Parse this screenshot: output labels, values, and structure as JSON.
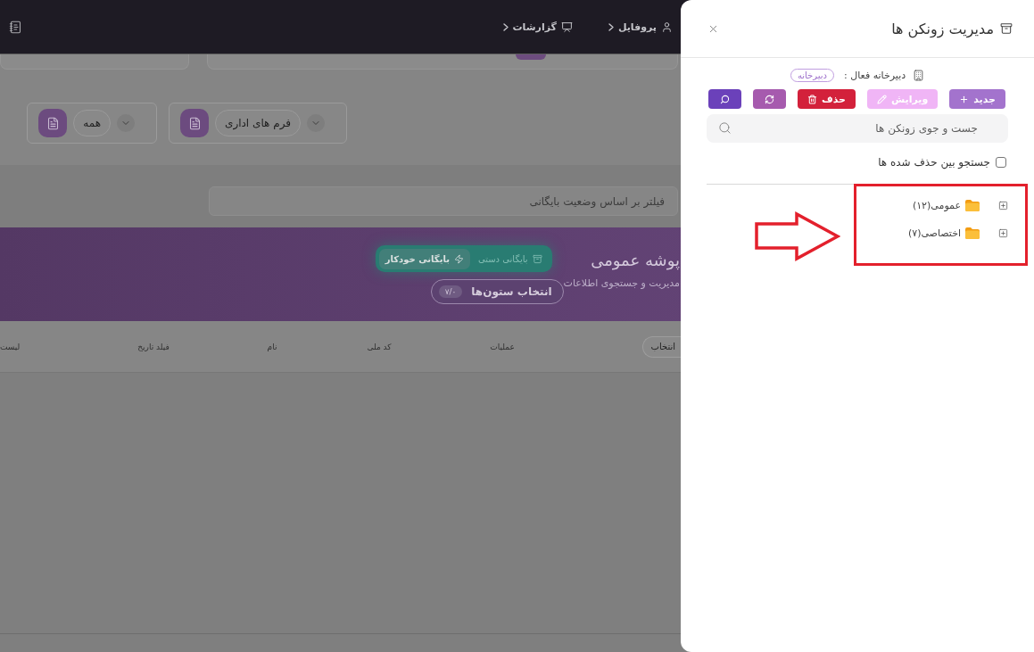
{
  "top_bar": {
    "items": [
      {
        "kind": "profile",
        "label": "پروفایل"
      },
      {
        "kind": "reports",
        "label": "گزارشات"
      }
    ]
  },
  "filters": {
    "dropdowns": [
      {
        "value": "فرم های اداری"
      },
      {
        "value": "همه"
      }
    ],
    "status_filter": {
      "placeholder": "فیلتر بر اساس وضعیت بایگانی"
    }
  },
  "banner": {
    "title": "پوشه عمومی",
    "subtitle": "مدیریت و جستجوی اطلاعات",
    "archive_modes": [
      {
        "kind": "manual",
        "label": "بایگانی دستی",
        "selected": false
      },
      {
        "kind": "auto",
        "label": "بایگانی خودکار",
        "selected": true
      }
    ],
    "columns_button": {
      "label": "انتخاب ستون‌ها",
      "badge": "۷/۰"
    }
  },
  "table": {
    "columns": [
      {
        "kind": "select",
        "label": "انتخاب"
      },
      {
        "kind": "text",
        "label": "عملیات"
      },
      {
        "kind": "text",
        "label": "کد ملی"
      },
      {
        "kind": "text",
        "label": "نام"
      },
      {
        "kind": "text",
        "label": "فیلد تاریخ"
      },
      {
        "kind": "text",
        "label": "لیست"
      }
    ]
  },
  "drawer": {
    "title": "مدیریت زونکن ها",
    "active_office": {
      "label": "دبیرخانه فعال :",
      "badge": "دبیرخانه"
    },
    "actions": [
      {
        "kind": "new",
        "label": "جدید"
      },
      {
        "kind": "edit",
        "label": "ویرایش"
      },
      {
        "kind": "delete",
        "label": "حذف"
      },
      {
        "kind": "refresh"
      },
      {
        "kind": "search"
      }
    ],
    "search": {
      "placeholder": "جست و جوی زونکن ها"
    },
    "deleted_filter": {
      "label": "جستجو بین حذف شده ها",
      "checked": false
    },
    "tree": [
      {
        "label": "عمومی(۱۲)",
        "expanded": false
      },
      {
        "label": "اختصاصی(۷)",
        "expanded": false
      }
    ]
  }
}
